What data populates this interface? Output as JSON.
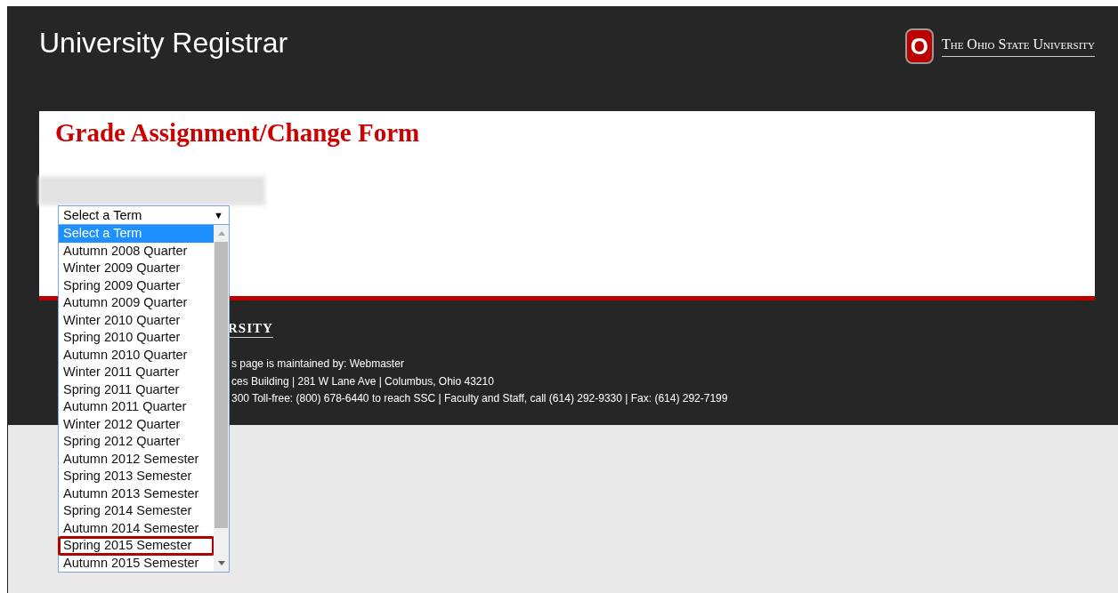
{
  "header": {
    "title": "University Registrar",
    "university": "The Ohio State University",
    "logo_letter": "O"
  },
  "form": {
    "title": "Grade Assignment/Change Form",
    "term_select": {
      "value": "Select a Term",
      "caret": "▼",
      "options": [
        {
          "label": "Select a Term",
          "selected": true,
          "highlighted": false
        },
        {
          "label": "Autumn 2008 Quarter",
          "selected": false,
          "highlighted": false
        },
        {
          "label": "Winter 2009 Quarter",
          "selected": false,
          "highlighted": false
        },
        {
          "label": "Spring 2009 Quarter",
          "selected": false,
          "highlighted": false
        },
        {
          "label": "Autumn 2009 Quarter",
          "selected": false,
          "highlighted": false
        },
        {
          "label": "Winter 2010 Quarter",
          "selected": false,
          "highlighted": false
        },
        {
          "label": "Spring 2010 Quarter",
          "selected": false,
          "highlighted": false
        },
        {
          "label": "Autumn 2010 Quarter",
          "selected": false,
          "highlighted": false
        },
        {
          "label": "Winter 2011 Quarter",
          "selected": false,
          "highlighted": false
        },
        {
          "label": "Spring 2011 Quarter",
          "selected": false,
          "highlighted": false
        },
        {
          "label": "Autumn 2011 Quarter",
          "selected": false,
          "highlighted": false
        },
        {
          "label": "Winter 2012 Quarter",
          "selected": false,
          "highlighted": false
        },
        {
          "label": "Spring 2012 Quarter",
          "selected": false,
          "highlighted": false
        },
        {
          "label": "Autumn 2012 Semester",
          "selected": false,
          "highlighted": false
        },
        {
          "label": "Spring 2013 Semester",
          "selected": false,
          "highlighted": false
        },
        {
          "label": "Autumn 2013 Semester",
          "selected": false,
          "highlighted": false
        },
        {
          "label": "Spring 2014 Semester",
          "selected": false,
          "highlighted": false
        },
        {
          "label": "Autumn 2014 Semester",
          "selected": false,
          "highlighted": false
        },
        {
          "label": "Spring 2015 Semester",
          "selected": false,
          "highlighted": true
        },
        {
          "label": "Autumn 2015 Semester",
          "selected": false,
          "highlighted": false
        }
      ]
    }
  },
  "footer": {
    "logo_fragment": "RSITY",
    "lines": [
      "s page is maintained by: Webmaster",
      "ces Building | 281 W Lane Ave | Columbus, Ohio 43210",
      "300 Toll-free: (800) 678-6440 to reach SSC | Faculty and Staff, call (614) 292-9330 | Fax: (614) 292-7199"
    ]
  }
}
